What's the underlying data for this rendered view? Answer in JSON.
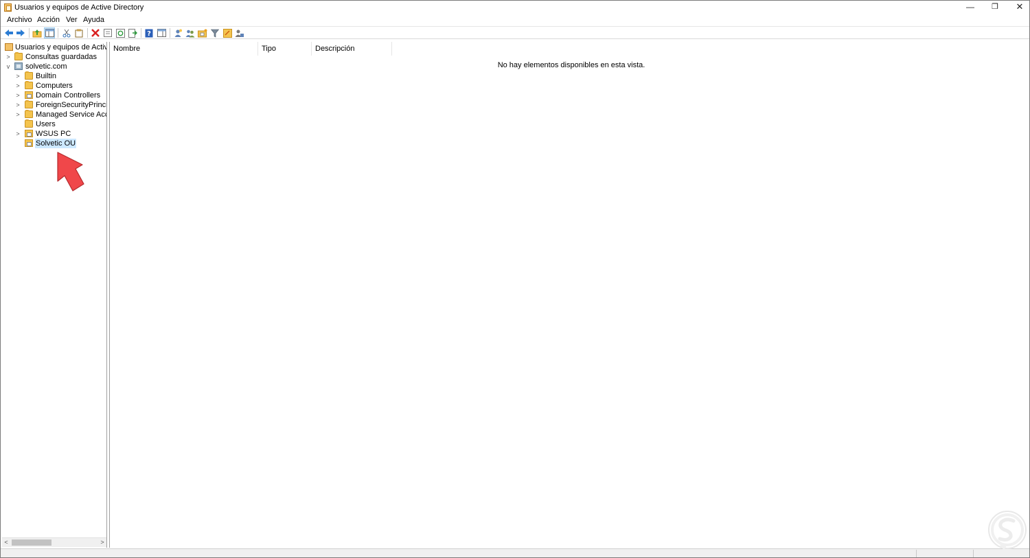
{
  "window": {
    "title": "Usuarios y equipos de Active Directory",
    "controls": {
      "minimize": "—",
      "maximize": "❐",
      "close": "✕"
    }
  },
  "menu": {
    "items": [
      "Archivo",
      "Acción",
      "Ver",
      "Ayuda"
    ]
  },
  "toolbar": {
    "buttons": [
      "back-icon",
      "forward-icon",
      "up-level-icon",
      "show-console-tree-icon",
      "cut-icon",
      "copy-icon",
      "delete-icon",
      "properties-icon",
      "refresh-icon",
      "export-list-icon",
      "help-icon",
      "show-action-pane-icon",
      "new-user-icon",
      "new-group-icon",
      "new-ou-icon",
      "filter-icon",
      "add-to-group-icon",
      "delegate-icon"
    ]
  },
  "tree": {
    "root": "Usuarios y equipos de Active Dir",
    "saved_queries": "Consultas guardadas",
    "domain": "solvetic.com",
    "children": [
      {
        "label": "Builtin",
        "type": "folder",
        "expandable": true
      },
      {
        "label": "Computers",
        "type": "folder",
        "expandable": true
      },
      {
        "label": "Domain Controllers",
        "type": "ou",
        "expandable": true
      },
      {
        "label": "ForeignSecurityPrincipals",
        "type": "folder",
        "expandable": true
      },
      {
        "label": "Managed Service Accour",
        "type": "folder",
        "expandable": true
      },
      {
        "label": "Users",
        "type": "folder",
        "expandable": false
      },
      {
        "label": "WSUS PC",
        "type": "ou",
        "expandable": true
      },
      {
        "label": "Solvetic OU",
        "type": "ou",
        "expandable": false,
        "selected": true
      }
    ]
  },
  "list": {
    "columns": [
      "Nombre",
      "Tipo",
      "Descripción"
    ],
    "empty_message": "No hay elementos disponibles en esta vista."
  },
  "colors": {
    "selection": "#cce8ff",
    "folder": "#f4c44e",
    "arrow": "#f0474a"
  }
}
